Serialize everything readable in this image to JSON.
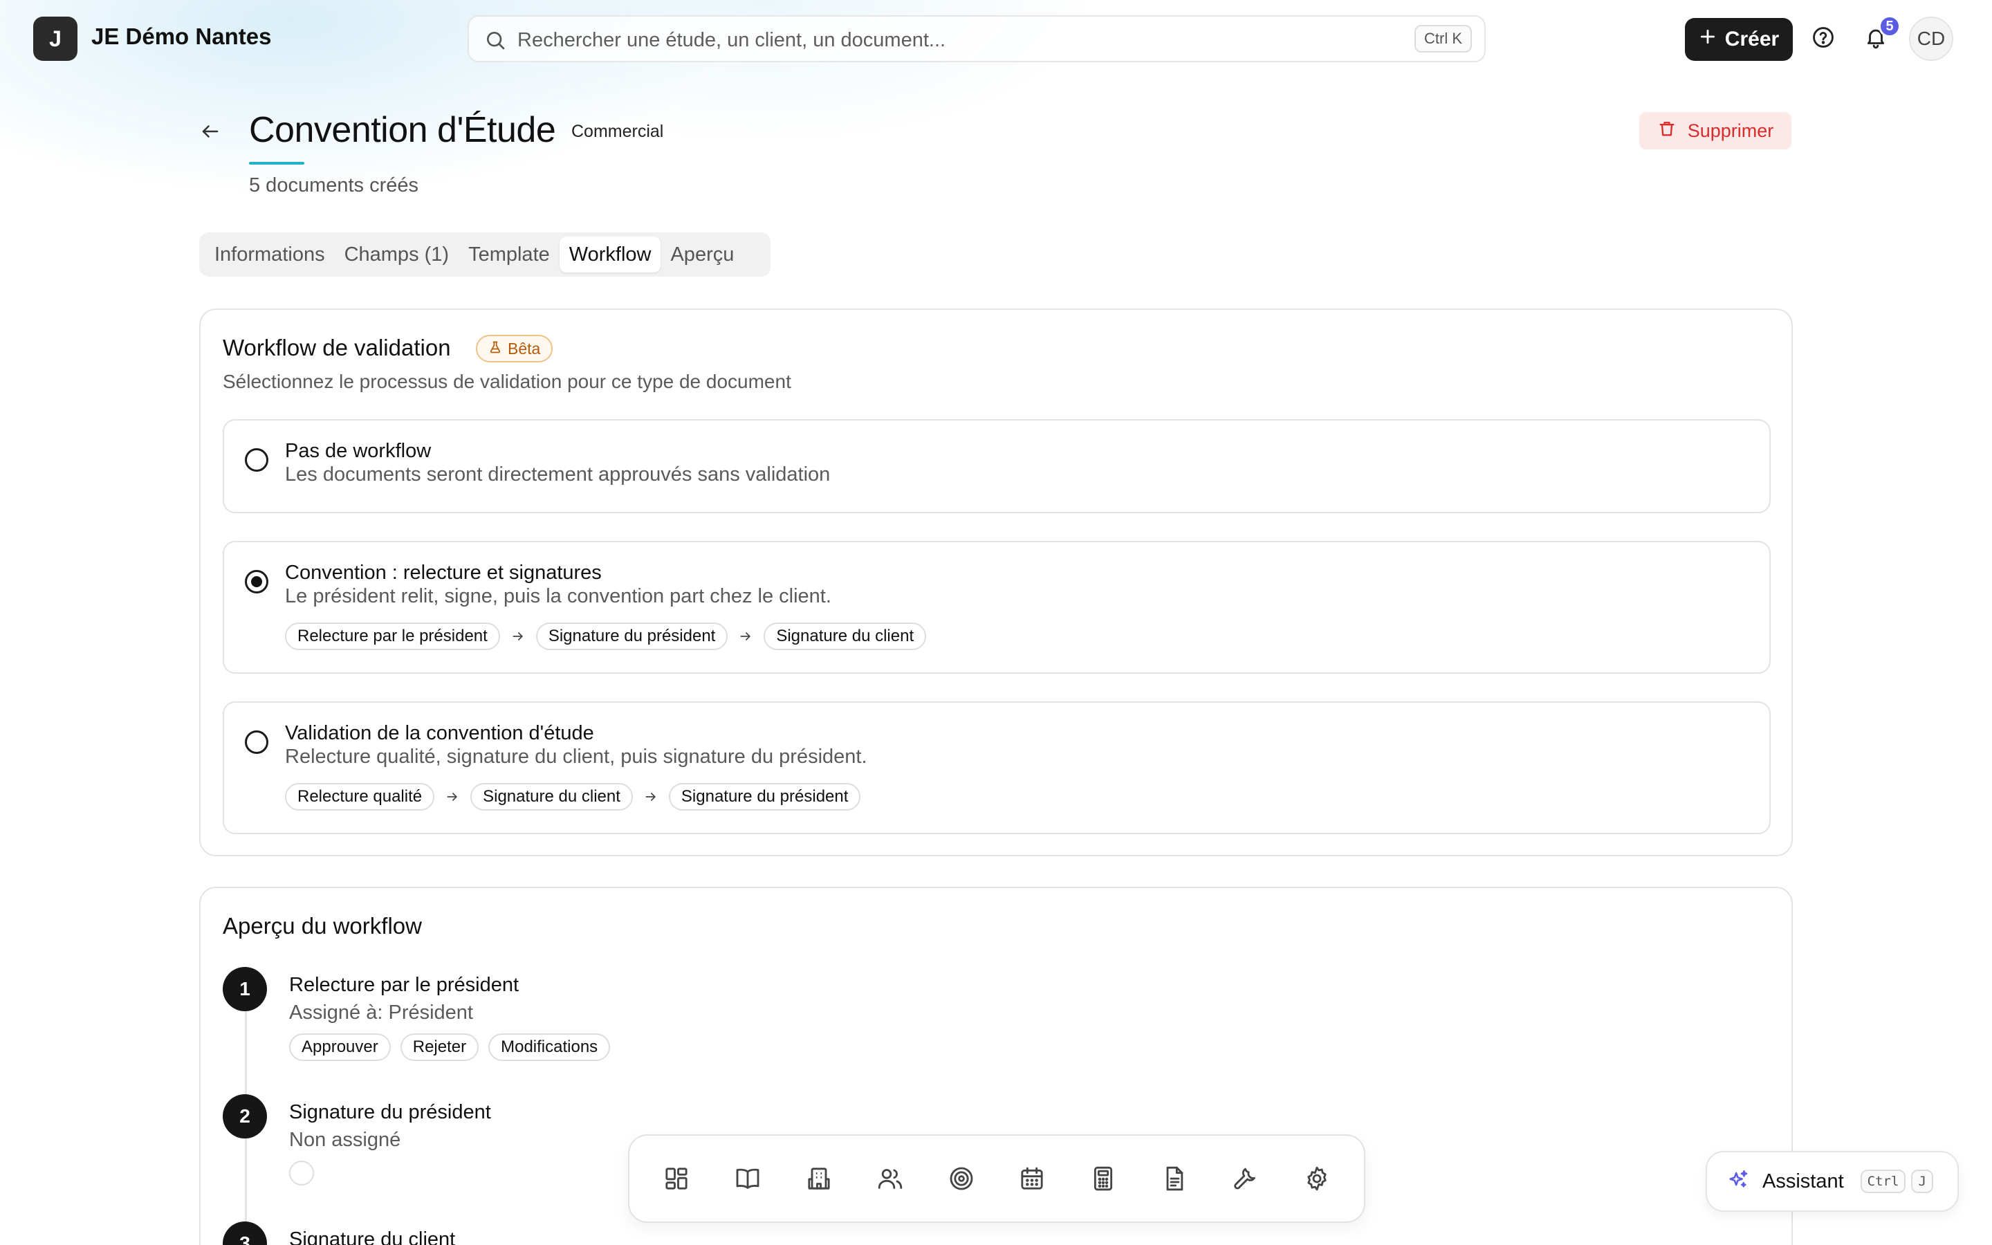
{
  "header": {
    "logo_letter": "J",
    "org_name": "JE Démo Nantes",
    "search_placeholder": "Rechercher une étude, un client, un document...",
    "search_shortcut": "Ctrl K",
    "create_label": "Créer",
    "notification_count": "5",
    "avatar_initials": "CD"
  },
  "page": {
    "title": "Convention d'Étude",
    "category": "Commercial",
    "doc_count": "5 documents créés",
    "delete_label": "Supprimer"
  },
  "tabs": [
    {
      "label": "Informations",
      "active": false
    },
    {
      "label": "Champs (1)",
      "active": false
    },
    {
      "label": "Template",
      "active": false
    },
    {
      "label": "Workflow",
      "active": true
    },
    {
      "label": "Aperçu",
      "active": false
    }
  ],
  "workflow_card": {
    "title": "Workflow de validation",
    "badge": "Bêta",
    "subtitle": "Sélectionnez le processus de validation pour ce type de document",
    "options": [
      {
        "title": "Pas de workflow",
        "description": "Les documents seront directement approuvés sans validation",
        "selected": false,
        "steps": []
      },
      {
        "title": "Convention : relecture et signatures",
        "description": "Le président relit, signe, puis la convention part chez le client.",
        "selected": true,
        "steps": [
          "Relecture par le président",
          "Signature du président",
          "Signature du client"
        ]
      },
      {
        "title": "Validation de la convention d'étude",
        "description": "Relecture qualité, signature du client, puis signature du président.",
        "selected": false,
        "steps": [
          "Relecture qualité",
          "Signature du client",
          "Signature du président"
        ]
      }
    ]
  },
  "preview_card": {
    "title": "Aperçu du workflow",
    "steps": [
      {
        "number": "1",
        "title": "Relecture par le président",
        "assignee": "Assigné à: Président",
        "actions": [
          "Approuver",
          "Rejeter",
          "Modifications"
        ]
      },
      {
        "number": "2",
        "title": "Signature du président",
        "assignee": "Non assigné",
        "actions": []
      },
      {
        "number": "3",
        "title": "Signature du client",
        "assignee": "",
        "actions": []
      }
    ]
  },
  "dock": {
    "items": [
      "dashboard-icon",
      "book-icon",
      "building-icon",
      "users-icon",
      "target-icon",
      "calendar-icon",
      "calculator-icon",
      "document-icon",
      "wrench-icon",
      "settings-icon"
    ]
  },
  "assistant": {
    "label": "Assistant",
    "shortcut_keys": [
      "Ctrl",
      "J"
    ]
  },
  "colors": {
    "accent": "#22b2c7",
    "danger": "#d92b2b",
    "danger_bg": "#fde8e8",
    "beta": "#b45b0a",
    "badge": "#5b5ce2",
    "dark": "#1c1c1c"
  }
}
